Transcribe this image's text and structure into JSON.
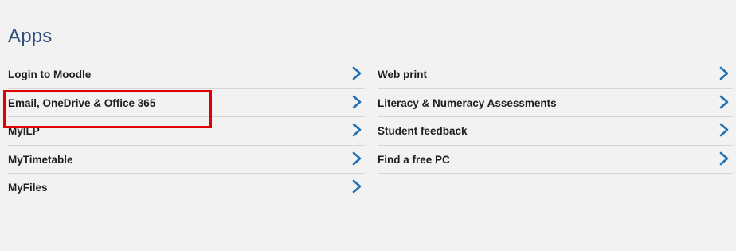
{
  "section": {
    "title": "Apps"
  },
  "apps_left": [
    {
      "label": "Login to Moodle",
      "icon": "chevron-right-icon"
    },
    {
      "label": "Email, OneDrive & Office 365",
      "icon": "chevron-right-icon"
    },
    {
      "label": "MyILP",
      "icon": "chevron-right-icon"
    },
    {
      "label": "MyTimetable",
      "icon": "chevron-right-icon"
    },
    {
      "label": "MyFiles",
      "icon": "chevron-right-icon"
    }
  ],
  "apps_right": [
    {
      "label": "Web print",
      "icon": "chevron-right-icon"
    },
    {
      "label": "Literacy & Numeracy Assessments",
      "icon": "chevron-right-icon"
    },
    {
      "label": "Student feedback",
      "icon": "chevron-right-icon"
    },
    {
      "label": "Find a free PC",
      "icon": "chevron-right-icon"
    }
  ],
  "colors": {
    "title": "#2f4f7f",
    "chevron": "#1f6fb5",
    "highlight": "#e00000",
    "divider": "#d7d7d7",
    "background": "#f2f2f2"
  }
}
